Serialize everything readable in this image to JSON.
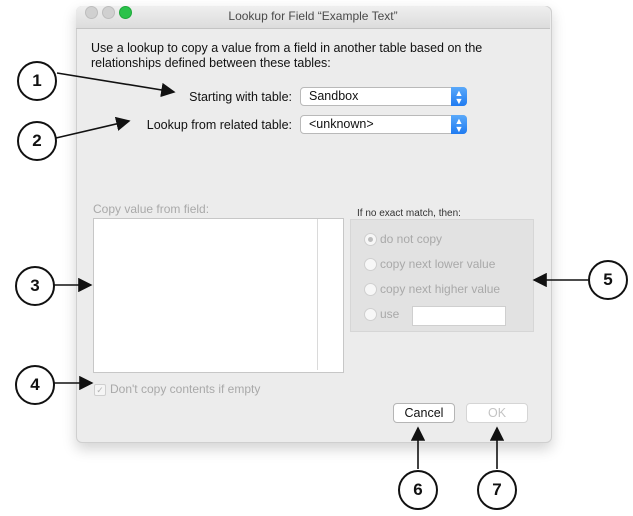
{
  "dialog": {
    "title": "Lookup for Field “Example Text”",
    "intro": "Use a lookup to copy a value from a field in another table based on the relationships defined between these tables:",
    "starting_label": "Starting with table:",
    "starting_value": "Sandbox",
    "related_label": "Lookup from related table:",
    "related_value": "<unknown>",
    "copy_label": "Copy value from field:",
    "no_match_label": "If no exact match, then:",
    "options": [
      "do not copy",
      "copy next lower value",
      "copy next higher value",
      "use"
    ],
    "dont_copy_label": "Don't copy contents if empty",
    "cancel": "Cancel",
    "ok": "OK"
  },
  "callouts": [
    "1",
    "2",
    "3",
    "4",
    "5",
    "6",
    "7"
  ],
  "colors": {
    "accent": "#1f7bf1",
    "close": "#c9c9c9",
    "zoom": "#2ac24a"
  }
}
